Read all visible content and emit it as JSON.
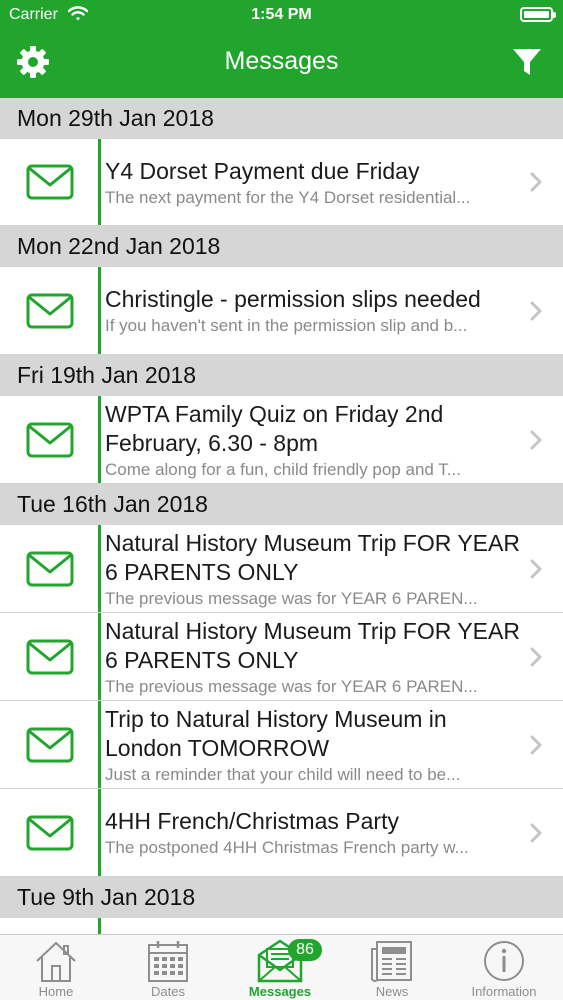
{
  "status_bar": {
    "carrier": "Carrier",
    "time": "1:54 PM"
  },
  "nav": {
    "title": "Messages",
    "left_icon": "gear-icon",
    "right_icon": "filter-icon"
  },
  "colors": {
    "brand_green": "#21a52c",
    "section_bg": "#d6d6d6",
    "preview_text": "#8a8a8a"
  },
  "sections": [
    {
      "date": "Mon 29th Jan 2018",
      "messages": [
        {
          "title": "Y4 Dorset Payment due Friday",
          "preview": "The next payment for the Y4 Dorset residential..."
        }
      ]
    },
    {
      "date": "Mon 22nd Jan 2018",
      "messages": [
        {
          "title": "Christingle - permission slips needed",
          "preview": "If you haven't sent in the permission slip and b..."
        }
      ]
    },
    {
      "date": "Fri 19th Jan 2018",
      "messages": [
        {
          "title": "WPTA Family Quiz on Friday 2nd February, 6.30 - 8pm",
          "preview": "Come along for a fun, child friendly pop and T..."
        }
      ]
    },
    {
      "date": "Tue 16th Jan 2018",
      "messages": [
        {
          "title": "Natural History Museum Trip FOR YEAR 6 PARENTS ONLY",
          "preview": "The previous message was for YEAR 6 PAREN..."
        },
        {
          "title": "Natural History Museum Trip FOR YEAR 6 PARENTS ONLY",
          "preview": "The previous message was for YEAR 6 PAREN..."
        },
        {
          "title": "Trip to Natural History Museum in London TOMORROW",
          "preview": "Just a reminder that your child will need to be..."
        },
        {
          "title": "4HH French/Christmas Party",
          "preview": "The postponed 4HH Christmas French party w..."
        }
      ]
    },
    {
      "date": "Tue 9th Jan 2018",
      "messages": []
    }
  ],
  "tabs": [
    {
      "label": "Home",
      "icon": "home-icon"
    },
    {
      "label": "Dates",
      "icon": "calendar-icon"
    },
    {
      "label": "Messages",
      "icon": "envelope-icon",
      "badge": "86",
      "active": true
    },
    {
      "label": "News",
      "icon": "newspaper-icon"
    },
    {
      "label": "Information",
      "icon": "info-icon"
    }
  ]
}
